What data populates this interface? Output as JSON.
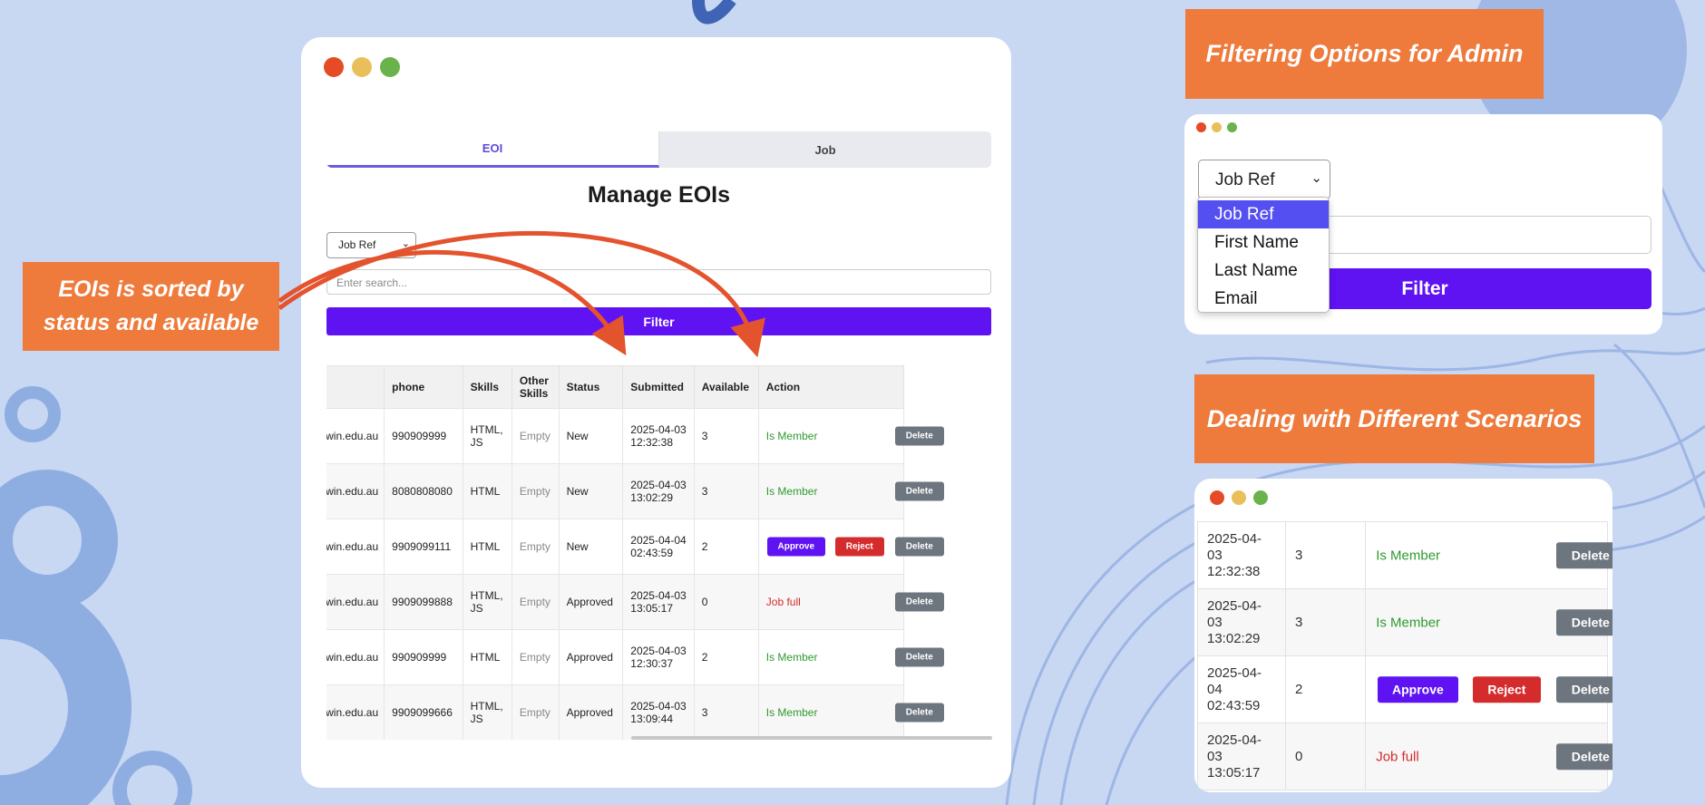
{
  "colors": {
    "background": "#c8d7f2",
    "accent_orange": "#ee7a3b",
    "primary_purple": "#5f12f2",
    "danger_red": "#d42c2c",
    "delete_gray": "#6d757e",
    "member_green": "#2e9a2e"
  },
  "callouts": {
    "sorted": "EOIs is sorted by status and available",
    "filtering": "Filtering Options for Admin",
    "scenarios": "Dealing with Different Scenarios"
  },
  "main_window": {
    "tabs": [
      {
        "label": "EOI",
        "active": true
      },
      {
        "label": "Job",
        "active": false
      }
    ],
    "title": "Manage EOIs",
    "select_value": "Job Ref",
    "search_placeholder": "Enter search...",
    "filter_label": "Filter",
    "table": {
      "headers": [
        "phone",
        "Skills",
        "Other Skills",
        "Status",
        "Submitted",
        "Available",
        "Action"
      ],
      "rows": [
        {
          "email": "ent.swin.edu.au",
          "phone": "990909999",
          "skills": "HTML, JS",
          "other": "Empty",
          "status": "New",
          "submitted": "2025-04-03 12:32:38",
          "available": "3",
          "action": "member",
          "member_label": "Is Member",
          "delete": "Delete"
        },
        {
          "email": "ent.swin.edu.au",
          "phone": "8080808080",
          "skills": "HTML",
          "other": "Empty",
          "status": "New",
          "submitted": "2025-04-03 13:02:29",
          "available": "3",
          "action": "member",
          "member_label": "Is Member",
          "delete": "Delete"
        },
        {
          "email": "ent.swin.edu.au",
          "phone": "9909099111",
          "skills": "HTML",
          "other": "Empty",
          "status": "New",
          "submitted": "2025-04-04 02:43:59",
          "available": "2",
          "action": "approve",
          "approve": "Approve",
          "reject": "Reject",
          "delete": "Delete"
        },
        {
          "email": "ent.swin.edu.au",
          "phone": "9909099888",
          "skills": "HTML, JS",
          "other": "Empty",
          "status": "Approved",
          "submitted": "2025-04-03 13:05:17",
          "available": "0",
          "action": "full",
          "full_label": "Job full",
          "delete": "Delete"
        },
        {
          "email": "ent.swin.edu.au",
          "phone": "990909999",
          "skills": "HTML",
          "other": "Empty",
          "status": "Approved",
          "submitted": "2025-04-03 12:30:37",
          "available": "2",
          "action": "member",
          "member_label": "Is Member",
          "delete": "Delete"
        },
        {
          "email": "ent.swin.edu.au",
          "phone": "9909099666",
          "skills": "HTML, JS",
          "other": "Empty",
          "status": "Approved",
          "submitted": "2025-04-03 13:09:44",
          "available": "3",
          "action": "member",
          "member_label": "Is Member",
          "delete": "Delete"
        }
      ]
    }
  },
  "filter_window": {
    "select_value": "Job Ref",
    "options": [
      "Job Ref",
      "First Name",
      "Last Name",
      "Email"
    ],
    "selected_option": "Job Ref",
    "filter_label": "Filter"
  },
  "scenarios_window": {
    "rows": [
      {
        "submitted": "2025-04-03 12:32:38",
        "available": "3",
        "action": "member",
        "member_label": "Is Member",
        "delete": "Delete"
      },
      {
        "submitted": "2025-04-03 13:02:29",
        "available": "3",
        "action": "member",
        "member_label": "Is Member",
        "delete": "Delete"
      },
      {
        "submitted": "2025-04-04 02:43:59",
        "available": "2",
        "action": "approve",
        "approve": "Approve",
        "reject": "Reject",
        "delete": "Delete"
      },
      {
        "submitted": "2025-04-03 13:05:17",
        "available": "0",
        "action": "full",
        "full_label": "Job full",
        "delete": "Delete"
      }
    ]
  }
}
